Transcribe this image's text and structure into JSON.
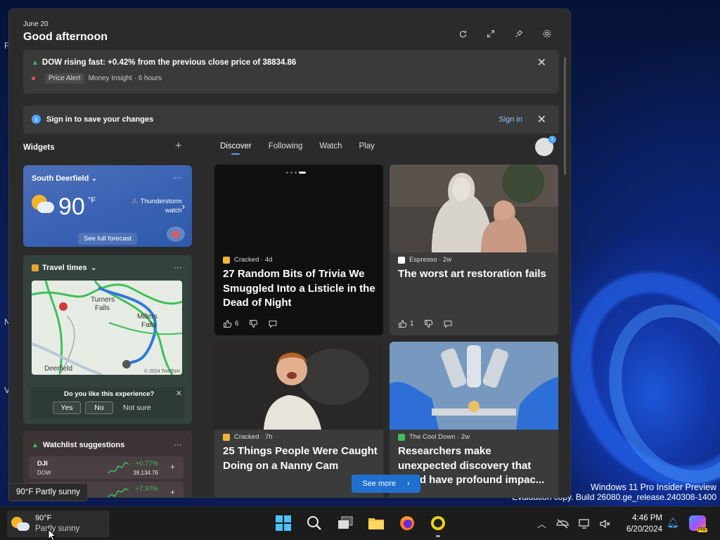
{
  "desktop": {
    "watermark_line1": "Windows 11 Pro Insider Preview",
    "watermark_line2": "Evaluation copy. Build 26080.ge_release.240308-1400",
    "side_letters": [
      "F",
      "N",
      "V"
    ]
  },
  "panel": {
    "date": "June 20",
    "greeting": "Good afternoon"
  },
  "alert": {
    "title": "DOW rising fast: +0.42% from the previous close price of 38834.86",
    "tag": "Price Alert",
    "source": "Money Insight · 6 hours"
  },
  "signin_banner": {
    "text": "Sign in to save your changes",
    "link": "Sign in"
  },
  "widgets": {
    "label": "Widgets",
    "add": "+"
  },
  "tabs": [
    "Discover",
    "Following",
    "Watch",
    "Play"
  ],
  "avatar_badge": "1",
  "weather": {
    "location": "South Deerfield",
    "temp": "90",
    "unit": "°F",
    "alert_line1": "Thunderstorm",
    "alert_line2": "watch",
    "forecast": "See full forecast",
    "more": "···"
  },
  "travel": {
    "title": "Travel times",
    "more": "···",
    "map_labels": {
      "turners": "Turners",
      "falls": "Falls",
      "millers": "Millers",
      "millers_falls": "Falls",
      "deerfield": "Deerfield",
      "copyright": "© 2024 TomTom"
    },
    "feedback": {
      "question": "Do you like this experience?",
      "yes": "Yes",
      "no": "No",
      "not_sure": "Not sure",
      "close": "✕"
    }
  },
  "watchlist": {
    "title": "Watchlist suggestions",
    "more": "···",
    "stocks": [
      {
        "symbol": "DJI",
        "name": "DOW",
        "change": "+0.77%",
        "value": "39,134.76"
      },
      {
        "symbol": "",
        "name": "",
        "change": "+7.97%",
        "value": ""
      }
    ]
  },
  "news": [
    {
      "source": "Cracked · 4d",
      "title": "27 Random Bits of Trivia We Smuggled Into a Listicle in the Dead of Night",
      "likes": "6",
      "source_color": "#f0b43a"
    },
    {
      "source": "Espresso · 2w",
      "title": "The worst art restoration fails",
      "likes": "1",
      "source_color": "#ffffff"
    },
    {
      "source": "Cracked · 7h",
      "title": "25 Things People Were Caught Doing on a Nanny Cam",
      "likes": "",
      "source_color": "#f0b43a"
    },
    {
      "source": "The Cool Down · 2w",
      "title": "Researchers make unexpected discovery that could have profound impac...",
      "likes": "",
      "source_color": "#3fbf5a"
    }
  ],
  "see_more": "See more",
  "tooltip": "90°F Partly sunny",
  "taskbar": {
    "temp": "90°F",
    "condition": "Partly sunny",
    "time": "4:46 PM",
    "date": "6/20/2024",
    "copilot_badge": "PRE"
  },
  "colors": {
    "accent": "#4aa3ff",
    "positive": "#3fbf5a",
    "panel_bg": "#2b2b2b"
  }
}
